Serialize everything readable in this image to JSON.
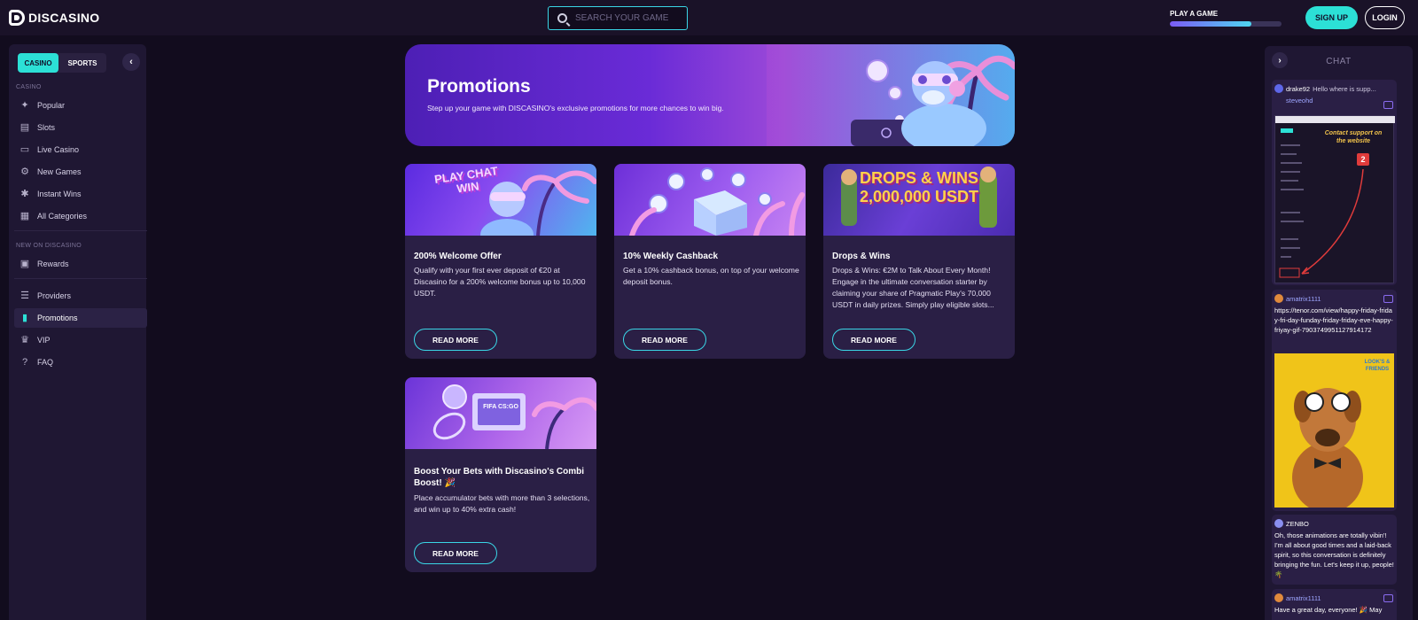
{
  "brand": {
    "name": "DISCASINO"
  },
  "search": {
    "placeholder": "SEARCH YOUR GAME"
  },
  "play_game": {
    "label": "PLAY A GAME",
    "progress_pct": 73
  },
  "auth": {
    "signup_label": "SIGN UP",
    "login_label": "LOGIN"
  },
  "sidebar": {
    "tabs": [
      "CASINO",
      "SPORTS"
    ],
    "casino_section": "CASINO",
    "casino_items": [
      {
        "label": "Popular",
        "icon": "sparkle-icon"
      },
      {
        "label": "Slots",
        "icon": "slots-icon"
      },
      {
        "label": "Live Casino",
        "icon": "live-icon"
      },
      {
        "label": "New Games",
        "icon": "new-games-icon"
      },
      {
        "label": "Instant Wins",
        "icon": "instant-wins-icon"
      },
      {
        "label": "All Categories",
        "icon": "grid-icon"
      }
    ],
    "new_section": "NEW ON DISCASINO",
    "new_items": [
      {
        "label": "Rewards",
        "icon": "gift-icon"
      }
    ],
    "other_items": [
      {
        "label": "Providers",
        "icon": "providers-icon"
      },
      {
        "label": "Promotions",
        "icon": "promotions-icon",
        "active": true
      },
      {
        "label": "VIP",
        "icon": "crown-icon"
      },
      {
        "label": "FAQ",
        "icon": "question-icon"
      }
    ]
  },
  "hero": {
    "title": "Promotions",
    "subtitle": "Step up your game with DISCASINO's exclusive promotions for more chances to win big."
  },
  "promotions": [
    {
      "image_text": "PLAY CHAT WIN",
      "title": "200% Welcome Offer",
      "description": "Qualify with your first ever deposit of €20 at Discasino for a 200% welcome bonus up to 10,000 USDT.",
      "button": "READ MORE"
    },
    {
      "image_text": "",
      "title": "10% Weekly Cashback",
      "description": "Get a 10% cashback bonus, on top of your welcome deposit bonus.",
      "button": "READ MORE"
    },
    {
      "image_text": "DROPS & WINS 2,000,000 USDT",
      "title": "Drops & Wins",
      "description": "Drops & Wins: €2M to Talk About Every Month! Engage in the ultimate conversation starter by claiming your share of Pragmatic Play's 70,000 USDT in daily prizes. Simply play eligible slots...",
      "button": "READ MORE"
    },
    {
      "image_text": "FIFA CS:GO",
      "title": "Boost Your Bets with Discasino's Combi Boost! 🎉",
      "description": "Place accumulator bets with more than 3 selections, and win up to 40% extra cash!",
      "button": "READ MORE"
    }
  ],
  "chat": {
    "title": "CHAT",
    "messages": [
      {
        "reply_user": "drake92",
        "reply_text": "Hello where is supp...",
        "user": "steveohd",
        "image_caption": "Contact support on the website",
        "image_step": "2"
      },
      {
        "user": "amatrix1111",
        "text": "https://tenor.com/view/happy-friday-friday-fri-day-funday-friday-friday-eve-happy-friyay-gif-7903749951127914172",
        "gif_badge": "LOOK'S & FRIENDS"
      },
      {
        "user": "ZENBO",
        "text": "Oh, those animations are totally vibin'! I'm all about good times and a laid-back spirit, so this conversation is definitely bringing the fun. Let's keep it up, people! 🌴"
      },
      {
        "user": "amatrix1111",
        "text": "Have a great day, everyone! 🎉 May"
      }
    ]
  },
  "colors": {
    "accent": "#2ce0d6",
    "background": "#120c1e",
    "panel": "#1f1733",
    "card": "#2a1f45"
  }
}
